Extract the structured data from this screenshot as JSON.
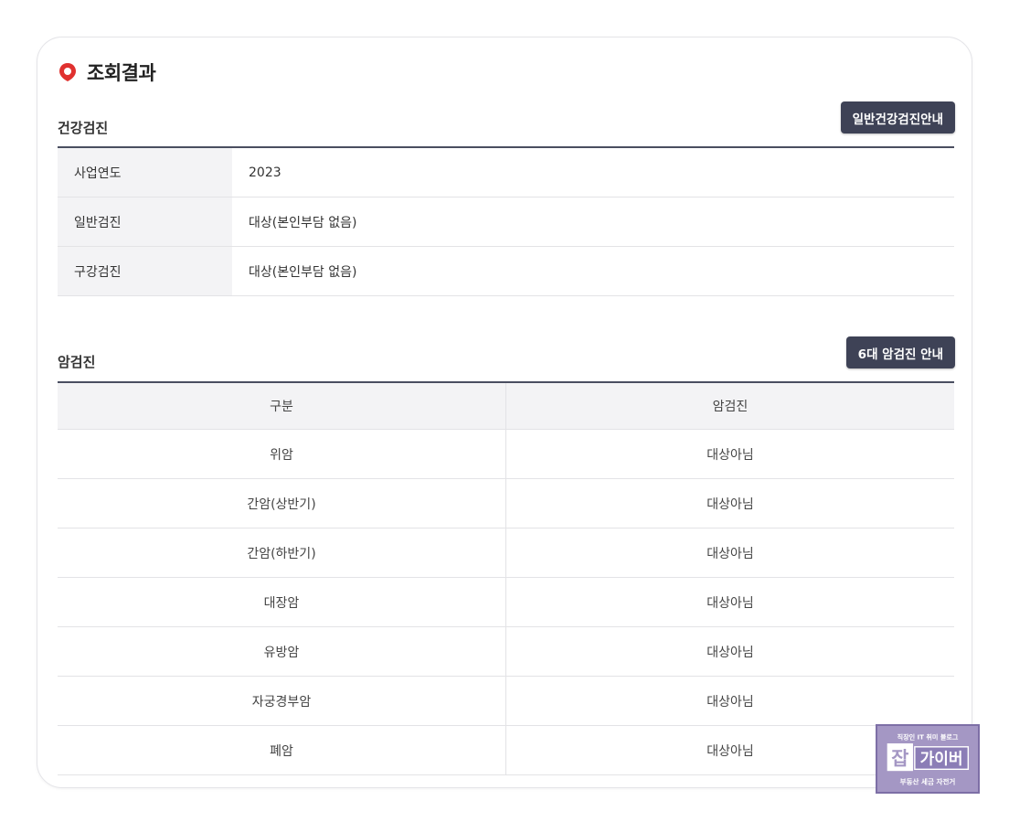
{
  "section_title": "조회결과",
  "health": {
    "title": "건강검진",
    "button": "일반건강검진안내",
    "rows": [
      {
        "label": "사업연도",
        "value": "2023"
      },
      {
        "label": "일반검진",
        "value": "대상(본인부담 없음)"
      },
      {
        "label": "구강검진",
        "value": "대상(본인부담 없음)"
      }
    ]
  },
  "cancer": {
    "title": "암검진",
    "button": "6대 암검진 안내",
    "headers": [
      "구분",
      "암검진"
    ],
    "rows": [
      {
        "type": "위암",
        "status": "대상아님"
      },
      {
        "type": "간암(상반기)",
        "status": "대상아님"
      },
      {
        "type": "간암(하반기)",
        "status": "대상아님"
      },
      {
        "type": "대장암",
        "status": "대상아님"
      },
      {
        "type": "유방암",
        "status": "대상아님"
      },
      {
        "type": "자궁경부암",
        "status": "대상아님"
      },
      {
        "type": "폐암",
        "status": "대상아님"
      }
    ]
  },
  "watermark": {
    "top": "직장인 IT 취미 블로그",
    "main_left": "잡",
    "main_right": "가이버",
    "bottom": "부동산 세금 자전거"
  },
  "colors": {
    "accent_red": "#e0312f",
    "button_bg": "#3e4256",
    "table_header_bg": "#f3f3f5",
    "logo_bg": "#a497c4"
  }
}
